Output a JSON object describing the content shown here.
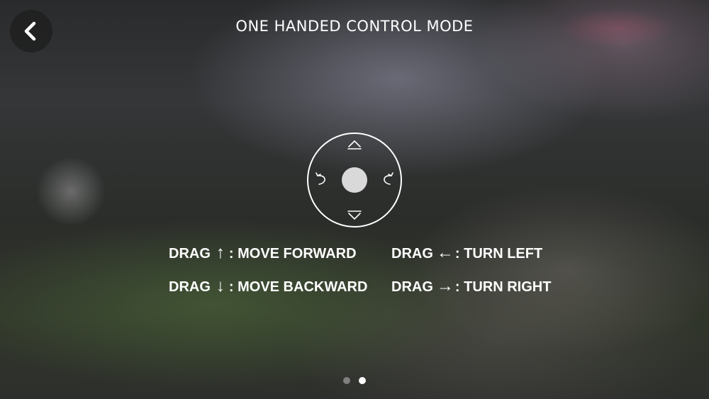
{
  "header": {
    "title": "ONE HANDED CONTROL MODE",
    "back_icon": "chevron-left-icon"
  },
  "joystick": {
    "icons": [
      "up-icon",
      "down-icon",
      "rotate-left-icon",
      "rotate-right-icon"
    ]
  },
  "instructions": [
    {
      "verb": "DRAG",
      "arrow": "↑",
      "action": ": MOVE FORWARD"
    },
    {
      "verb": "DRAG",
      "arrow": "↓",
      "action": ": MOVE BACKWARD"
    },
    {
      "verb": "DRAG",
      "arrow": "←",
      "action": ": TURN LEFT"
    },
    {
      "verb": "DRAG",
      "arrow": "→",
      "action": ": TURN RIGHT"
    }
  ],
  "pagination": {
    "total": 2,
    "active": 2
  }
}
